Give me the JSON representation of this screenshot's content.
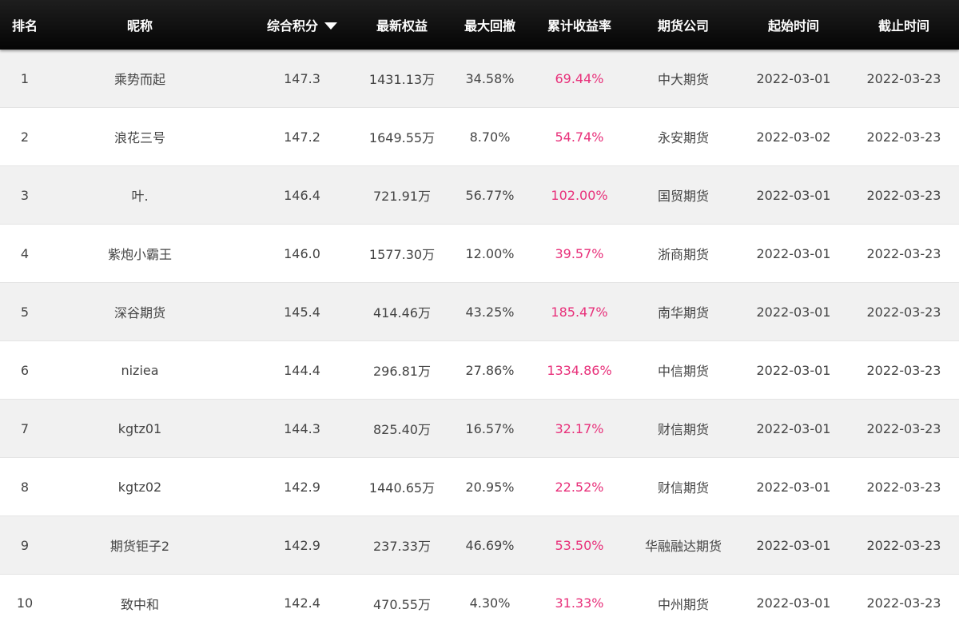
{
  "headers": {
    "rank": "排名",
    "name": "昵称",
    "score": "综合积分",
    "equity": "最新权益",
    "drawdown": "最大回撤",
    "return": "累计收益率",
    "company": "期货公司",
    "start": "起始时间",
    "end": "截止时间"
  },
  "sort": {
    "icon": "caret-down-icon",
    "column": "score",
    "direction": "desc"
  },
  "colors": {
    "header_bg": "#111111",
    "return_text": "#e8307a",
    "row_alt": "#f1f1f1"
  },
  "rows": [
    {
      "rank": "1",
      "name": "乘势而起",
      "score": "147.3",
      "equity": "1431.13万",
      "drawdown": "34.58%",
      "return": "69.44%",
      "company": "中大期货",
      "start": "2022-03-01",
      "end": "2022-03-23"
    },
    {
      "rank": "2",
      "name": "浪花三号",
      "score": "147.2",
      "equity": "1649.55万",
      "drawdown": "8.70%",
      "return": "54.74%",
      "company": "永安期货",
      "start": "2022-03-02",
      "end": "2022-03-23"
    },
    {
      "rank": "3",
      "name": "叶.",
      "score": "146.4",
      "equity": "721.91万",
      "drawdown": "56.77%",
      "return": "102.00%",
      "company": "国贸期货",
      "start": "2022-03-01",
      "end": "2022-03-23"
    },
    {
      "rank": "4",
      "name": "紫炮小霸王",
      "score": "146.0",
      "equity": "1577.30万",
      "drawdown": "12.00%",
      "return": "39.57%",
      "company": "浙商期货",
      "start": "2022-03-01",
      "end": "2022-03-23"
    },
    {
      "rank": "5",
      "name": "深谷期货",
      "score": "145.4",
      "equity": "414.46万",
      "drawdown": "43.25%",
      "return": "185.47%",
      "company": "南华期货",
      "start": "2022-03-01",
      "end": "2022-03-23"
    },
    {
      "rank": "6",
      "name": "niziea",
      "score": "144.4",
      "equity": "296.81万",
      "drawdown": "27.86%",
      "return": "1334.86%",
      "company": "中信期货",
      "start": "2022-03-01",
      "end": "2022-03-23"
    },
    {
      "rank": "7",
      "name": "kgtz01",
      "score": "144.3",
      "equity": "825.40万",
      "drawdown": "16.57%",
      "return": "32.17%",
      "company": "财信期货",
      "start": "2022-03-01",
      "end": "2022-03-23"
    },
    {
      "rank": "8",
      "name": "kgtz02",
      "score": "142.9",
      "equity": "1440.65万",
      "drawdown": "20.95%",
      "return": "22.52%",
      "company": "财信期货",
      "start": "2022-03-01",
      "end": "2022-03-23"
    },
    {
      "rank": "9",
      "name": "期货钜子2",
      "score": "142.9",
      "equity": "237.33万",
      "drawdown": "46.69%",
      "return": "53.50%",
      "company": "华融融达期货",
      "start": "2022-03-01",
      "end": "2022-03-23"
    },
    {
      "rank": "10",
      "name": "致中和",
      "score": "142.4",
      "equity": "470.55万",
      "drawdown": "4.30%",
      "return": "31.33%",
      "company": "中州期货",
      "start": "2022-03-01",
      "end": "2022-03-23"
    }
  ]
}
